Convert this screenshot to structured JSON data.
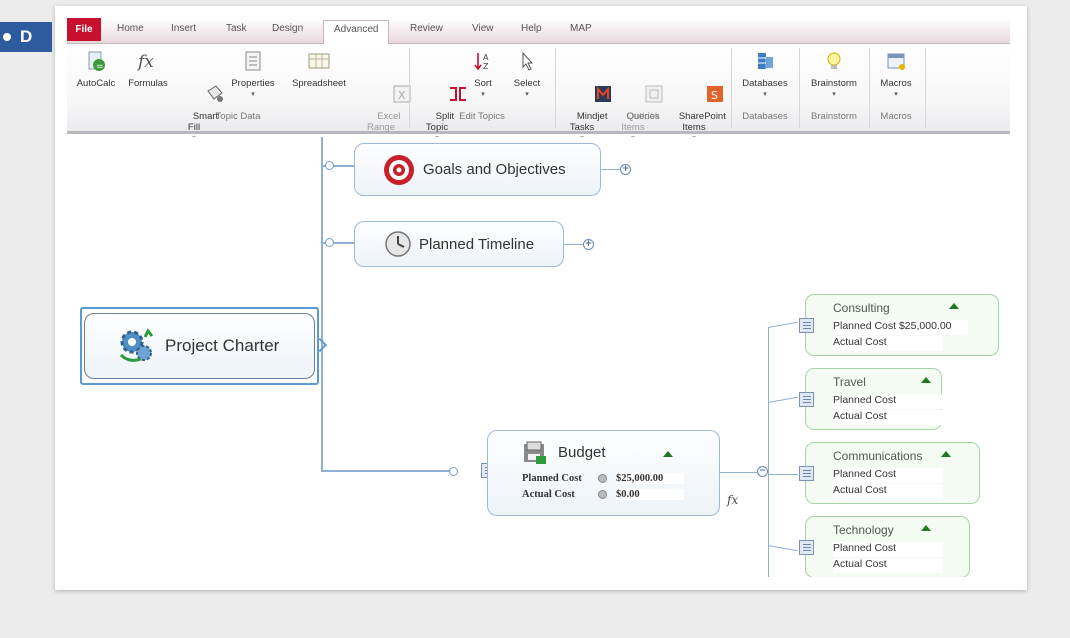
{
  "badge": {
    "label": "D"
  },
  "ribbon": {
    "tabs": [
      "File",
      "Home",
      "Insert",
      "Task",
      "Design",
      "Advanced",
      "Review",
      "View",
      "Help",
      "MAP"
    ],
    "active_tab": "Advanced",
    "buttons": [
      {
        "label": "AutoCalc",
        "icon": "autocalc-icon"
      },
      {
        "label": "Formulas",
        "icon": "fx-icon"
      },
      {
        "label": "Smart\nFill",
        "icon": "smart-fill-icon"
      },
      {
        "label": "Properties",
        "icon": "properties-icon"
      },
      {
        "label": "Spreadsheet",
        "icon": "spreadsheet-icon"
      },
      {
        "label": "Excel\nRange",
        "icon": "excel-range-icon",
        "disabled": true
      },
      {
        "label": "Split\nTopic",
        "icon": "split-topic-icon"
      },
      {
        "label": "Sort",
        "icon": "sort-icon"
      },
      {
        "label": "Select",
        "icon": "select-icon"
      },
      {
        "label": "Mindjet\nTasks",
        "icon": "mindjet-tasks-icon"
      },
      {
        "label": "Outlook\nItems",
        "icon": "outlook-items-icon",
        "disabled": true
      },
      {
        "label": "SharePoint\nItems",
        "icon": "sharepoint-items-icon"
      },
      {
        "label": "Databases",
        "icon": "databases-icon"
      },
      {
        "label": "Brainstorm",
        "icon": "brainstorm-icon"
      },
      {
        "label": "Macros",
        "icon": "macros-icon"
      }
    ],
    "groups": [
      "Topic Data",
      "Edit Topics",
      "Queries",
      "Databases",
      "Brainstorm",
      "Macros"
    ]
  },
  "map": {
    "central_topic": "Project Charter",
    "topics": [
      {
        "label": "Goals and Objectives",
        "icon": "target-icon"
      },
      {
        "label": "Planned Timeline",
        "icon": "clock-icon"
      }
    ],
    "budget": {
      "label": "Budget",
      "rows": [
        {
          "label": "Planned Cost",
          "value": "$25,000.00"
        },
        {
          "label": "Actual Cost",
          "value": "$0.00"
        }
      ],
      "formula_mark": "fx"
    },
    "subtopics": [
      {
        "name": "Consulting",
        "planned_label": "Planned Cost",
        "planned_value": "$25,000.00",
        "actual_label": "Actual Cost"
      },
      {
        "name": "Travel",
        "planned_label": "Planned Cost",
        "planned_value": "",
        "actual_label": "Actual Cost"
      },
      {
        "name": "Communications",
        "planned_label": "Planned Cost",
        "planned_value": "",
        "actual_label": "Actual Cost"
      },
      {
        "name": "Technology",
        "planned_label": "Planned Cost",
        "planned_value": "",
        "actual_label": "Actual Cost"
      }
    ],
    "expand_symbol": "+",
    "collapse_symbol": "−"
  },
  "colors": {
    "file_tab": "#c8102e",
    "badge": "#2e5b9e",
    "topic_border": "#9fb9d4",
    "subtopic_border": "#a8d4a8",
    "triangle": "#1f7a1f"
  }
}
